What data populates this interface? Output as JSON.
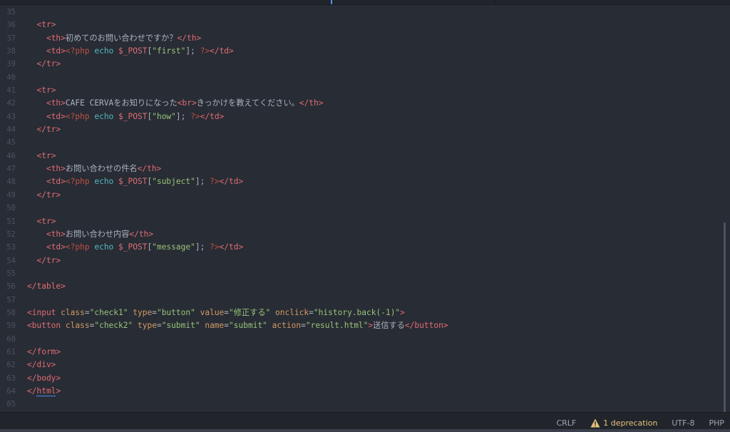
{
  "statusbar": {
    "line_ending": "CRLF",
    "deprecation": "1 deprecation",
    "encoding": "UTF-8",
    "grammar": "PHP"
  },
  "code": {
    "lines": [
      {
        "n": "35",
        "tokens": []
      },
      {
        "n": "36",
        "tokens": [
          [
            "",
            "  "
          ],
          [
            "tag",
            "<tr>"
          ]
        ]
      },
      {
        "n": "37",
        "tokens": [
          [
            "",
            "    "
          ],
          [
            "tag",
            "<th>"
          ],
          [
            "text",
            "初めてのお問い合わせですか？"
          ],
          [
            "tag",
            "</th>"
          ]
        ]
      },
      {
        "n": "38",
        "tokens": [
          [
            "",
            "    "
          ],
          [
            "tag",
            "<td>"
          ],
          [
            "php",
            "<?php"
          ],
          [
            "",
            " "
          ],
          [
            "kw",
            "echo"
          ],
          [
            "",
            " "
          ],
          [
            "var",
            "$_POST"
          ],
          [
            "punct",
            "["
          ],
          [
            "str",
            "\"first\""
          ],
          [
            "punct",
            "];"
          ],
          [
            "",
            " "
          ],
          [
            "php",
            "?>"
          ],
          [
            "tag",
            "</td>"
          ]
        ]
      },
      {
        "n": "39",
        "tokens": [
          [
            "",
            "  "
          ],
          [
            "tag",
            "</tr>"
          ]
        ]
      },
      {
        "n": "40",
        "tokens": []
      },
      {
        "n": "41",
        "tokens": [
          [
            "",
            "  "
          ],
          [
            "tag",
            "<tr>"
          ]
        ]
      },
      {
        "n": "42",
        "tokens": [
          [
            "",
            "    "
          ],
          [
            "tag",
            "<th>"
          ],
          [
            "text",
            "CAFE CERVAをお知りになった"
          ],
          [
            "tag",
            "<br>"
          ],
          [
            "text",
            "きっかけを教えてください。"
          ],
          [
            "tag",
            "</th>"
          ]
        ]
      },
      {
        "n": "43",
        "tokens": [
          [
            "",
            "    "
          ],
          [
            "tag",
            "<td>"
          ],
          [
            "php",
            "<?php"
          ],
          [
            "",
            " "
          ],
          [
            "kw",
            "echo"
          ],
          [
            "",
            " "
          ],
          [
            "var",
            "$_POST"
          ],
          [
            "punct",
            "["
          ],
          [
            "str",
            "\"how\""
          ],
          [
            "punct",
            "];"
          ],
          [
            "",
            " "
          ],
          [
            "php",
            "?>"
          ],
          [
            "tag",
            "</td>"
          ]
        ]
      },
      {
        "n": "44",
        "tokens": [
          [
            "",
            "  "
          ],
          [
            "tag",
            "</tr>"
          ]
        ]
      },
      {
        "n": "45",
        "tokens": []
      },
      {
        "n": "46",
        "tokens": [
          [
            "",
            "  "
          ],
          [
            "tag",
            "<tr>"
          ]
        ]
      },
      {
        "n": "47",
        "tokens": [
          [
            "",
            "    "
          ],
          [
            "tag",
            "<th>"
          ],
          [
            "text",
            "お問い合わせの件名"
          ],
          [
            "tag",
            "</th>"
          ]
        ]
      },
      {
        "n": "48",
        "tokens": [
          [
            "",
            "    "
          ],
          [
            "tag",
            "<td>"
          ],
          [
            "php",
            "<?php"
          ],
          [
            "",
            " "
          ],
          [
            "kw",
            "echo"
          ],
          [
            "",
            " "
          ],
          [
            "var",
            "$_POST"
          ],
          [
            "punct",
            "["
          ],
          [
            "str",
            "\"subject\""
          ],
          [
            "punct",
            "];"
          ],
          [
            "",
            " "
          ],
          [
            "php",
            "?>"
          ],
          [
            "tag",
            "</td>"
          ]
        ]
      },
      {
        "n": "49",
        "tokens": [
          [
            "",
            "  "
          ],
          [
            "tag",
            "</tr>"
          ]
        ]
      },
      {
        "n": "50",
        "tokens": []
      },
      {
        "n": "51",
        "tokens": [
          [
            "",
            "  "
          ],
          [
            "tag",
            "<tr>"
          ]
        ]
      },
      {
        "n": "52",
        "tokens": [
          [
            "",
            "    "
          ],
          [
            "tag",
            "<th>"
          ],
          [
            "text",
            "お問い合わせ内容"
          ],
          [
            "tag",
            "</th>"
          ]
        ]
      },
      {
        "n": "53",
        "tokens": [
          [
            "",
            "    "
          ],
          [
            "tag",
            "<td>"
          ],
          [
            "php",
            "<?php"
          ],
          [
            "",
            " "
          ],
          [
            "kw",
            "echo"
          ],
          [
            "",
            " "
          ],
          [
            "var",
            "$_POST"
          ],
          [
            "punct",
            "["
          ],
          [
            "str",
            "\"message\""
          ],
          [
            "punct",
            "];"
          ],
          [
            "",
            " "
          ],
          [
            "php",
            "?>"
          ],
          [
            "tag",
            "</td>"
          ]
        ]
      },
      {
        "n": "54",
        "tokens": [
          [
            "",
            "  "
          ],
          [
            "tag",
            "</tr>"
          ]
        ]
      },
      {
        "n": "55",
        "tokens": []
      },
      {
        "n": "56",
        "tokens": [
          [
            "tag",
            "</table>"
          ]
        ]
      },
      {
        "n": "57",
        "tokens": []
      },
      {
        "n": "58",
        "tokens": [
          [
            "tag",
            "<input"
          ],
          [
            "",
            " "
          ],
          [
            "attr",
            "class"
          ],
          [
            "punct",
            "="
          ],
          [
            "str",
            "\"check1\""
          ],
          [
            "",
            " "
          ],
          [
            "attr",
            "type"
          ],
          [
            "punct",
            "="
          ],
          [
            "str",
            "\"button\""
          ],
          [
            "",
            " "
          ],
          [
            "attr",
            "value"
          ],
          [
            "punct",
            "="
          ],
          [
            "str",
            "\"修正する\""
          ],
          [
            "",
            " "
          ],
          [
            "attr",
            "onclick"
          ],
          [
            "punct",
            "="
          ],
          [
            "str",
            "\"history.back(-1)\""
          ],
          [
            "tag",
            ">"
          ]
        ]
      },
      {
        "n": "59",
        "tokens": [
          [
            "tag",
            "<button"
          ],
          [
            "",
            " "
          ],
          [
            "attr",
            "class"
          ],
          [
            "punct",
            "="
          ],
          [
            "str",
            "\"check2\""
          ],
          [
            "",
            " "
          ],
          [
            "attr",
            "type"
          ],
          [
            "punct",
            "="
          ],
          [
            "str",
            "\"submit\""
          ],
          [
            "",
            " "
          ],
          [
            "attr",
            "name"
          ],
          [
            "punct",
            "="
          ],
          [
            "str",
            "\"submit\""
          ],
          [
            "",
            " "
          ],
          [
            "attr",
            "action"
          ],
          [
            "punct",
            "="
          ],
          [
            "str",
            "\"result.html\""
          ],
          [
            "tag",
            ">"
          ],
          [
            "text",
            "送信する"
          ],
          [
            "tag",
            "</button>"
          ]
        ]
      },
      {
        "n": "60",
        "tokens": []
      },
      {
        "n": "61",
        "tokens": [
          [
            "tag",
            "</form>"
          ]
        ]
      },
      {
        "n": "62",
        "tokens": [
          [
            "tag",
            "</div>"
          ]
        ]
      },
      {
        "n": "63",
        "tokens": [
          [
            "tag",
            "</body>"
          ]
        ]
      },
      {
        "n": "64",
        "tokens": [
          [
            "tag",
            "</"
          ],
          [
            "tag underline",
            "html"
          ],
          [
            "tag",
            ">"
          ]
        ]
      },
      {
        "n": "65",
        "tokens": []
      }
    ]
  },
  "icons": {
    "warning": "warning-triangle-icon"
  },
  "colors": {
    "background": "#282c34",
    "tag": "#e06c75",
    "attribute": "#d19a66",
    "string": "#98c379",
    "keyword": "#56b6c2",
    "warning": "#e5c07b"
  }
}
